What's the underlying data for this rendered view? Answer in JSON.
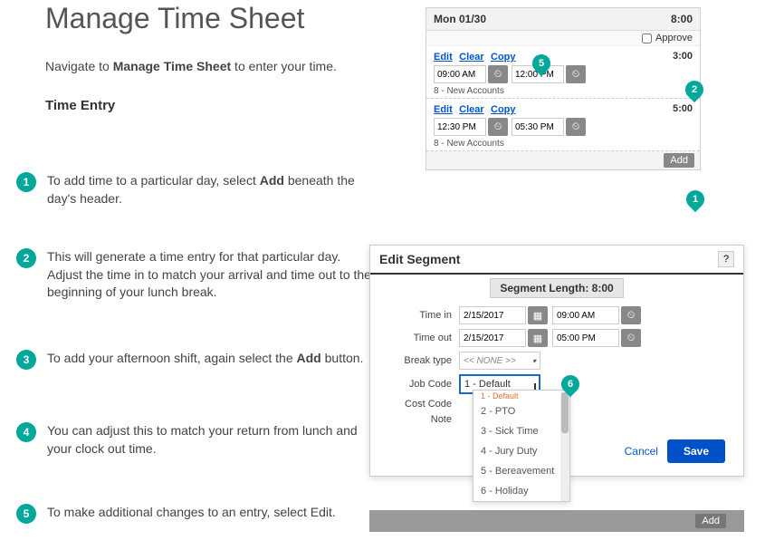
{
  "title": "Manage Time Sheet",
  "intro_pre": "Navigate to ",
  "intro_bold": "Manage Time Sheet",
  "intro_post": " to enter your time.",
  "section_head": "Time Entry",
  "steps": [
    {
      "n": "1",
      "pre": "To add time to a particular day, select ",
      "bold": "Add",
      "post": " beneath the day's header."
    },
    {
      "n": "2",
      "pre": "This will generate a time entry for that particular day. Adjust the time in to match your arrival and time out to the beginning of your lunch break.",
      "bold": "",
      "post": ""
    },
    {
      "n": "3",
      "pre": "To add your afternoon shift, again select the ",
      "bold": "Add",
      "post": " button."
    },
    {
      "n": "4",
      "pre": "You can adjust this to match your return from lunch and your clock out time.",
      "bold": "",
      "post": ""
    },
    {
      "n": "5",
      "pre": "To make additional changes to an entry, select Edit.",
      "bold": "",
      "post": ""
    }
  ],
  "ts": {
    "date": "Mon 01/30",
    "total": "8:00",
    "approve": "Approve",
    "link_edit": "Edit",
    "link_clear": "Clear",
    "link_copy": "Copy",
    "add": "Add",
    "job": "8 - New Accounts",
    "entries": [
      {
        "dur": "3:00",
        "in": "09:00 AM",
        "out": "12:00 PM"
      },
      {
        "dur": "5:00",
        "in": "12:30 PM",
        "out": "05:30 PM"
      }
    ]
  },
  "es": {
    "title": "Edit Segment",
    "help": "?",
    "seglen": "Segment Length: 8:00",
    "labels": {
      "tin": "Time in",
      "tout": "Time out",
      "brk": "Break type",
      "jc": "Job Code",
      "cc": "Cost Code",
      "note": "Note"
    },
    "date": "2/15/2017",
    "tin": "09:00 AM",
    "tout": "05:00 PM",
    "brk": "<< NONE >>",
    "jc": "1 - Default",
    "cancel": "Cancel",
    "save": "Save"
  },
  "dd": {
    "cut": "1 - Default",
    "opts": [
      "2 - PTO",
      "3 - Sick Time",
      "4 - Jury Duty",
      "5 - Bereavement",
      "6 - Holiday"
    ]
  },
  "callouts": {
    "c1": "1",
    "c2": "2",
    "c5": "5",
    "c6": "6"
  }
}
